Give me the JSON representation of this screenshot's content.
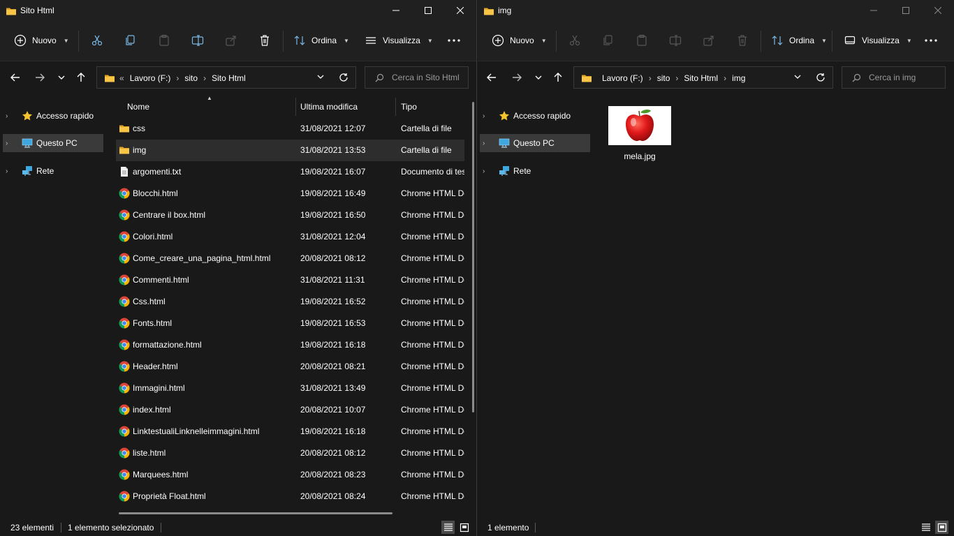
{
  "left_window": {
    "title": "Sito Html",
    "toolbar": {
      "new_label": "Nuovo",
      "sort_label": "Ordina",
      "view_label": "Visualizza"
    },
    "address": {
      "overflow": "«",
      "crumbs": [
        "Lavoro (F:)",
        "sito",
        "Sito Html"
      ]
    },
    "search_placeholder": "Cerca in Sito Html",
    "nav": {
      "quick_access": "Accesso rapido",
      "this_pc": "Questo PC",
      "network": "Rete"
    },
    "columns": {
      "name": "Nome",
      "modified": "Ultima modifica",
      "type": "Tipo"
    },
    "files": [
      {
        "name": "css",
        "date": "31/08/2021 12:07",
        "type": "Cartella di file",
        "icon": "folder-icon"
      },
      {
        "name": "img",
        "date": "31/08/2021 13:53",
        "type": "Cartella di file",
        "icon": "folder-icon",
        "selected": true
      },
      {
        "name": "argomenti.txt",
        "date": "19/08/2021 16:07",
        "type": "Documento di testo",
        "icon": "text-file-icon"
      },
      {
        "name": "Blocchi.html",
        "date": "19/08/2021 16:49",
        "type": "Chrome HTML Document",
        "icon": "chrome-icon"
      },
      {
        "name": "Centrare il box.html",
        "date": "19/08/2021 16:50",
        "type": "Chrome HTML Document",
        "icon": "chrome-icon"
      },
      {
        "name": "Colori.html",
        "date": "31/08/2021 12:04",
        "type": "Chrome HTML Document",
        "icon": "chrome-icon"
      },
      {
        "name": "Come_creare_una_pagina_html.html",
        "date": "20/08/2021 08:12",
        "type": "Chrome HTML Document",
        "icon": "chrome-icon"
      },
      {
        "name": "Commenti.html",
        "date": "31/08/2021 11:31",
        "type": "Chrome HTML Document",
        "icon": "chrome-icon"
      },
      {
        "name": "Css.html",
        "date": "19/08/2021 16:52",
        "type": "Chrome HTML Document",
        "icon": "chrome-icon"
      },
      {
        "name": "Fonts.html",
        "date": "19/08/2021 16:53",
        "type": "Chrome HTML Document",
        "icon": "chrome-icon"
      },
      {
        "name": "formattazione.html",
        "date": "19/08/2021 16:18",
        "type": "Chrome HTML Document",
        "icon": "chrome-icon"
      },
      {
        "name": "Header.html",
        "date": "20/08/2021 08:21",
        "type": "Chrome HTML Document",
        "icon": "chrome-icon"
      },
      {
        "name": "Immagini.html",
        "date": "31/08/2021 13:49",
        "type": "Chrome HTML Document",
        "icon": "chrome-icon"
      },
      {
        "name": "index.html",
        "date": "20/08/2021 10:07",
        "type": "Chrome HTML Document",
        "icon": "chrome-icon"
      },
      {
        "name": "LinktestualiLinknelleimmagini.html",
        "date": "19/08/2021 16:18",
        "type": "Chrome HTML Document",
        "icon": "chrome-icon"
      },
      {
        "name": "liste.html",
        "date": "20/08/2021 08:12",
        "type": "Chrome HTML Document",
        "icon": "chrome-icon"
      },
      {
        "name": "Marquees.html",
        "date": "20/08/2021 08:23",
        "type": "Chrome HTML Document",
        "icon": "chrome-icon"
      },
      {
        "name": "Proprietà Float.html",
        "date": "20/08/2021 08:24",
        "type": "Chrome HTML Document",
        "icon": "chrome-icon"
      }
    ],
    "status": {
      "count": "23 elementi",
      "selection": "1 elemento selezionato"
    }
  },
  "right_window": {
    "title": "img",
    "toolbar": {
      "new_label": "Nuovo",
      "sort_label": "Ordina",
      "view_label": "Visualizza"
    },
    "address": {
      "crumbs": [
        "Lavoro (F:)",
        "sito",
        "Sito Html",
        "img"
      ]
    },
    "search_placeholder": "Cerca in img",
    "nav": {
      "quick_access": "Accesso rapido",
      "this_pc": "Questo PC",
      "network": "Rete"
    },
    "file": {
      "name": "mela.jpg",
      "icon": "apple-thumbnail"
    },
    "status": {
      "count": "1 elemento"
    }
  },
  "colors": {
    "background": "#191919",
    "titlebar": "#202020",
    "selection": "#3a3a3a",
    "folder_yellow": "#f8c547",
    "chrome_red": "#db4437",
    "chrome_green": "#0f9d58",
    "chrome_yellow": "#f4b400",
    "chrome_blue": "#4285f4",
    "pc_blue": "#3fa7e0"
  }
}
